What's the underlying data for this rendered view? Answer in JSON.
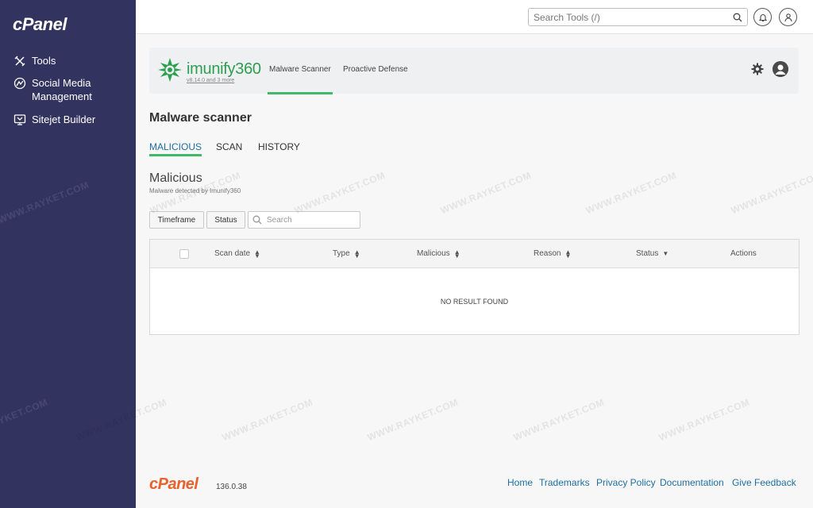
{
  "sidebar": {
    "logo": "cPanel",
    "items": [
      {
        "label": "Tools",
        "icon": "tools-icon"
      },
      {
        "label": "Social Media Management",
        "icon": "social-media-icon"
      },
      {
        "label": "Sitejet Builder",
        "icon": "sitejet-icon"
      }
    ]
  },
  "topbar": {
    "search_placeholder": "Search Tools (/)",
    "notifications_icon": "bell-icon",
    "user_icon": "user-icon"
  },
  "imunify": {
    "brand_text": "imunify",
    "brand_number": "360",
    "version": "v8.14.0 and 3 more",
    "tabs": [
      {
        "label": "Malware Scanner",
        "active": true
      },
      {
        "label": "Proactive Defense",
        "active": false
      }
    ],
    "accent": "#41b96a"
  },
  "page": {
    "title": "Malware scanner",
    "tabs": [
      {
        "label": "MALICIOUS",
        "active": true
      },
      {
        "label": "SCAN",
        "active": false
      },
      {
        "label": "HISTORY",
        "active": false
      }
    ],
    "section_title": "Malicious",
    "section_subtitle": "Malware detected by Imunify360"
  },
  "filters": {
    "timeframe": "Timeframe",
    "status": "Status",
    "search_placeholder": "Search"
  },
  "table": {
    "columns": [
      "Scan date",
      "Type",
      "Malicious",
      "Reason",
      "Status",
      "Actions"
    ],
    "empty_message": "NO RESULT FOUND"
  },
  "watermark": "WWW.RAYKET.COM",
  "footer": {
    "logo": "cPanel",
    "version": "136.0.38",
    "links": [
      "Home",
      "Trademarks",
      "Privacy Policy",
      "Documentation",
      "Give Feedback"
    ]
  }
}
